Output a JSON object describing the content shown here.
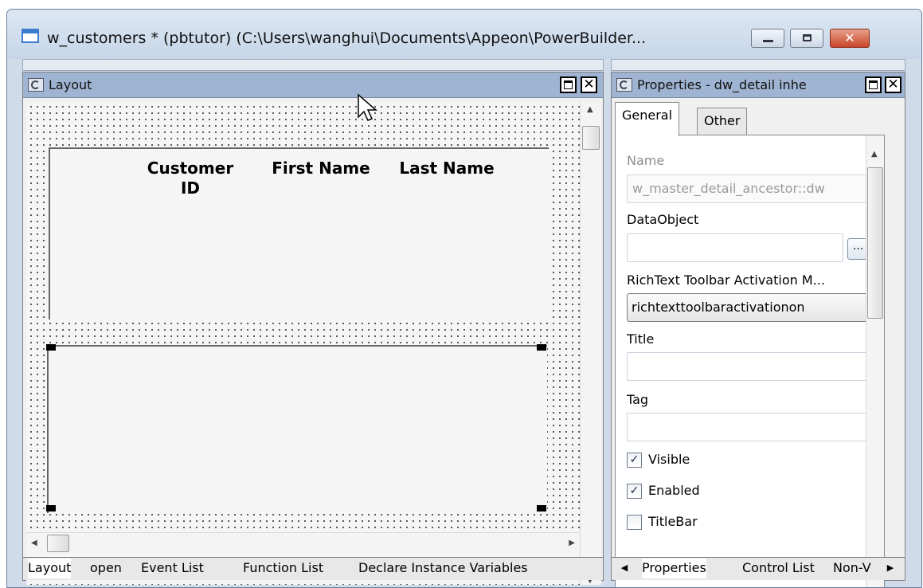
{
  "window": {
    "title": "w_customers * (pbtutor) (C:\\Users\\wanghui\\Documents\\Appeon\\PowerBuilder...",
    "close_symbol": "✕"
  },
  "layout_pane": {
    "title": "Layout",
    "close_symbol": "✕",
    "columns": [
      "Customer\nID",
      "First Name",
      "Last Name"
    ],
    "bottom_tabs": [
      "Layout",
      "open",
      "Event List",
      "Function List",
      "Declare Instance Variables"
    ]
  },
  "properties_pane": {
    "title": "Properties - dw_detail inhe",
    "close_symbol": "✕",
    "tabs": [
      "General",
      "Other"
    ],
    "name_label": "Name",
    "name_value": "w_master_detail_ancestor::dw",
    "dataobject_label": "DataObject",
    "dataobject_value": "",
    "ellipsis_label": "...",
    "richtext_label": "RichText Toolbar Activation M...",
    "richtext_value": "richtexttoolbaractivationon",
    "title_label": "Title",
    "title_value": "",
    "tag_label": "Tag",
    "tag_value": "",
    "checkboxes": [
      {
        "label": "Visible",
        "checked": true
      },
      {
        "label": "Enabled",
        "checked": true
      },
      {
        "label": "TitleBar",
        "checked": false
      }
    ],
    "bottom_tabs": [
      "Properties",
      "Control List",
      "Non-V"
    ]
  }
}
